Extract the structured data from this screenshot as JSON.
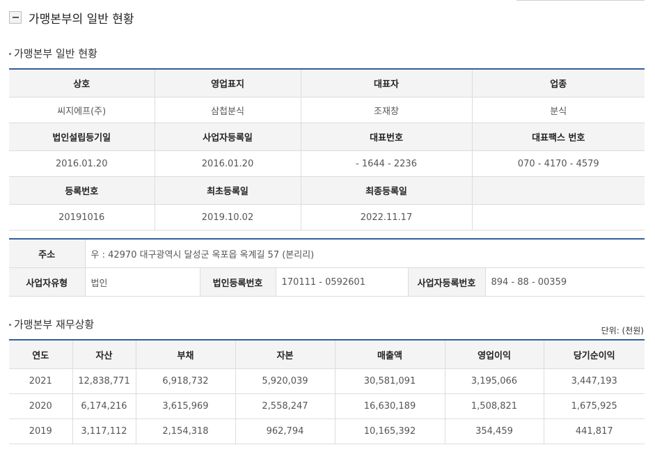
{
  "header": {
    "title": "가맹본부의 일반 현황"
  },
  "general": {
    "title": "가맹본부 일반 현황",
    "row1_headers": [
      "상호",
      "영업표지",
      "대표자",
      "업종"
    ],
    "row1_values": [
      "씨지에프(주)",
      "삼첩분식",
      "조재창",
      "분식"
    ],
    "row2_headers": [
      "법인설립등기일",
      "사업자등록일",
      "대표번호",
      "대표팩스 번호"
    ],
    "row2_values": [
      "2016.01.20",
      "2016.01.20",
      "- 1644 - 2236",
      "070 - 4170 - 4579"
    ],
    "row3_headers": [
      "등록번호",
      "최초등록일",
      "최종등록일",
      ""
    ],
    "row3_values": [
      "20191016",
      "2019.10.02",
      "2022.11.17",
      ""
    ]
  },
  "address": {
    "label": "주소",
    "value": "우 : 42970 대구광역시 달성군 옥포읍 옥계길 57 (본리리)",
    "biz_type_label": "사업자유형",
    "biz_type_value": "법인",
    "corp_no_label": "법인등록번호",
    "corp_no_value": "170111 - 0592601",
    "biz_no_label": "사업자등록번호",
    "biz_no_value": "894 - 88 - 00359"
  },
  "finance": {
    "title": "가맹본부 재무상황",
    "unit": "단위: (천원)",
    "headers": [
      "연도",
      "자산",
      "부채",
      "자본",
      "매출액",
      "영업이익",
      "당기순이익"
    ],
    "rows": [
      [
        "2021",
        "12,838,771",
        "6,918,732",
        "5,920,039",
        "30,581,091",
        "3,195,066",
        "3,447,193"
      ],
      [
        "2020",
        "6,174,216",
        "3,615,969",
        "2,558,247",
        "16,630,189",
        "1,508,821",
        "1,675,925"
      ],
      [
        "2019",
        "3,117,112",
        "2,154,318",
        "962,794",
        "10,165,392",
        "354,459",
        "441,817"
      ]
    ]
  },
  "colors": {
    "accent": "#2f5f98",
    "header_bg": "#f4f4f4",
    "border": "#dcdcdc"
  }
}
